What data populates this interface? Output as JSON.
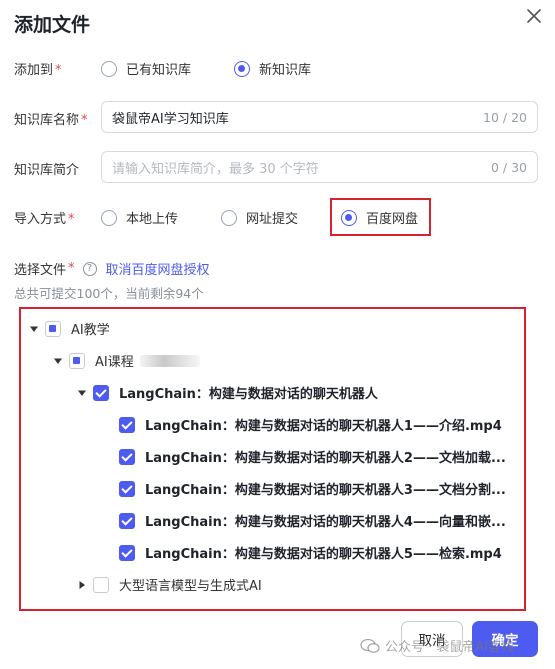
{
  "dialog": {
    "title": "添加文件"
  },
  "add_to": {
    "label": "添加到",
    "required": "*",
    "options": [
      {
        "label": "已有知识库",
        "selected": false
      },
      {
        "label": "新知识库",
        "selected": true
      }
    ]
  },
  "kb_name": {
    "label": "知识库名称",
    "required": "*",
    "value": "袋鼠帝AI学习知识库",
    "count": "10 / 20"
  },
  "kb_desc": {
    "label": "知识库简介",
    "placeholder": "请输入知识库简介，最多 30  个字符",
    "count": "0 / 30"
  },
  "import": {
    "label": "导入方式",
    "required": "*",
    "options": [
      {
        "label": "本地上传",
        "selected": false
      },
      {
        "label": "网址提交",
        "selected": false
      },
      {
        "label": "百度网盘",
        "selected": true
      }
    ]
  },
  "files": {
    "label": "选择文件",
    "required": "*",
    "help": "?",
    "link": "取消百度网盘授权",
    "note": "总共可提交100个，当前剩余94个"
  },
  "tree": {
    "root": "AI教学",
    "course": "AI课程",
    "group": "LangChain：构建与数据对话的聊天机器人",
    "items": [
      "LangChain：构建与数据对话的聊天机器人1——介绍.mp4",
      "LangChain：构建与数据对话的聊天机器人2——文档加载...",
      "LangChain：构建与数据对话的聊天机器人3——文档分割...",
      "LangChain：构建与数据对话的聊天机器人4——向量和嵌...",
      "LangChain：构建与数据对话的聊天机器人5——检索.mp4"
    ],
    "other": "大型语言模型与生成式AI"
  },
  "buttons": {
    "cancel": "取消",
    "ok": "确定"
  },
  "watermark": "公众号 · 袋鼠帝AI客栈",
  "colors": {
    "accent": "#4d5bf0",
    "highlight": "#d5222f",
    "required": "#e5484d"
  }
}
